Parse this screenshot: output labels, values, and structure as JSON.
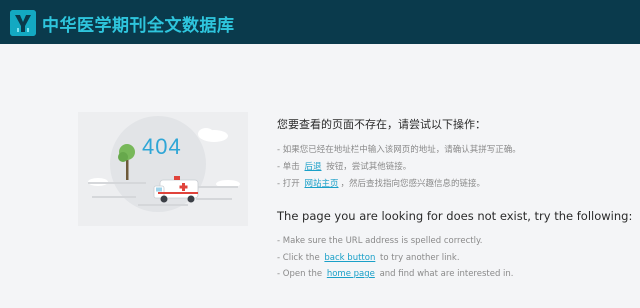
{
  "header": {
    "logo_text": "中华医学期刊全文数据库",
    "colors": {
      "bar": "#0a3a4c",
      "logo": "#2ec5dd",
      "mark": "#13a9c2"
    }
  },
  "illustration": {
    "code": "404",
    "icons": [
      "tree-icon",
      "ambulance-icon",
      "cloud-icon"
    ]
  },
  "zh": {
    "title": "您要查看的页面不存在，请尝试以下操作：",
    "line1": "- 如果您已经在地址栏中输入该网页的地址，请确认其拼写正确。",
    "line2_pre": "- 单击",
    "line2_link": "后退",
    "line2_post": "按钮，尝试其他链接。",
    "line3_pre": "- 打开",
    "line3_link": "网站主页",
    "line3_post": "，然后查找指向您感兴趣信息的链接。"
  },
  "en": {
    "title": "The page you are looking for does not exist, try the following:",
    "line1": "- Make sure the URL address is spelled correctly.",
    "line2_pre": "- Click the",
    "line2_link": "back button",
    "line2_post": "to try another link.",
    "line3_pre": "- Open the",
    "line3_link": "home page",
    "line3_post": "and find what are interested in."
  },
  "colors": {
    "link": "#1aa0c8",
    "accent_404": "#2fa6d6",
    "background": "#f4f5f7"
  }
}
